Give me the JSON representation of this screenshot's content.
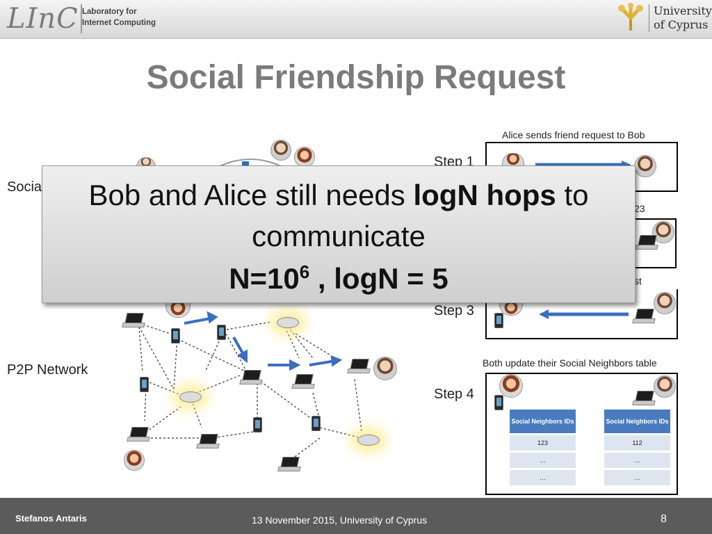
{
  "header": {
    "logo_text": "LInC",
    "lab_line1": "Laboratory for",
    "lab_line2": "Internet Computing",
    "university_line1": "University",
    "university_line2": "of Cyprus"
  },
  "title": "Social Friendship Request",
  "left_labels": {
    "social": "Social",
    "p2p": "P2P Network"
  },
  "steps": {
    "step1_label": "Step 1",
    "step1_caption": "Alice sends friend request to Bob",
    "step2_caption_fragment": "23",
    "step3_label": "Step 3",
    "step3_caption_fragment": "st",
    "step4_label": "Step 4",
    "step4_caption": "Both update their Social Neighbors table"
  },
  "overlay": {
    "line1_pre": "Bob and Alice still needs ",
    "line1_bold": "logN hops",
    "line1_post": " to",
    "line2": "communicate",
    "line3_a": "N=10",
    "line3_sup": "6",
    "line3_b": " , logN = 5"
  },
  "tables": {
    "alice": {
      "header": "Social Neighbors IDs",
      "rows": [
        "123",
        "…",
        "…"
      ]
    },
    "bob": {
      "header": "Social Neighbors IDs",
      "rows": [
        "112",
        "…",
        "…"
      ]
    }
  },
  "footer": {
    "author": "Stefanos Antaris",
    "date_place": "13 November 2015, University of Cyprus",
    "page": "8"
  }
}
